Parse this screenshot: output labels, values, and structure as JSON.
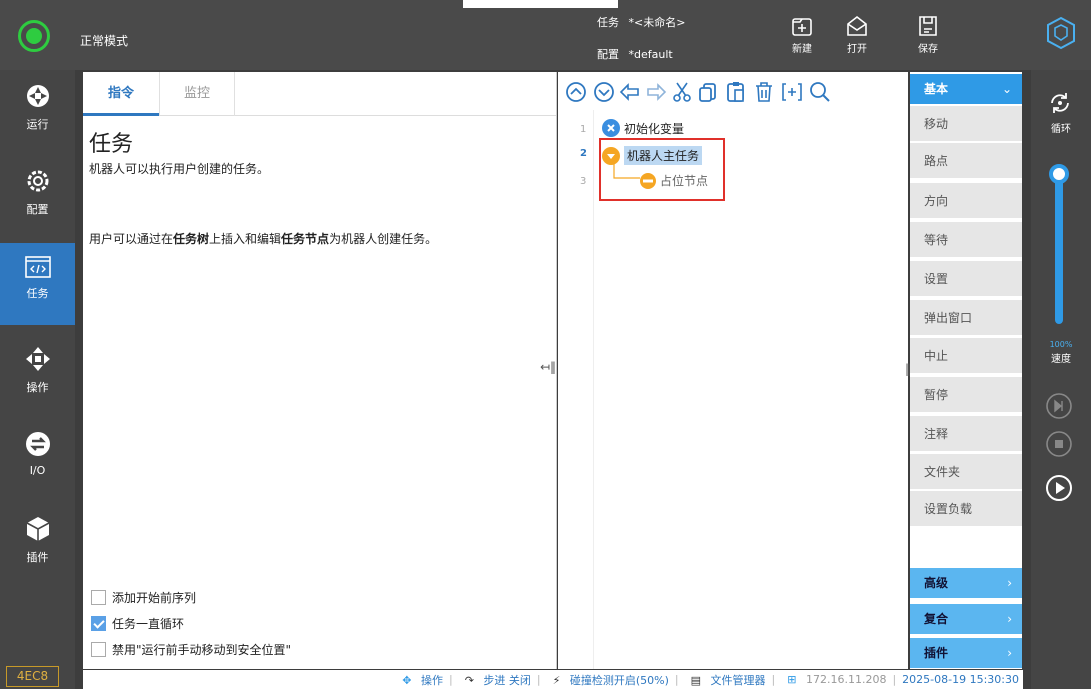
{
  "header": {
    "mode": "正常模式",
    "task_label": "任务",
    "task_value": "*<未命名>",
    "config_label": "配置",
    "config_value": "*default",
    "new_label": "新建",
    "open_label": "打开",
    "save_label": "保存"
  },
  "nav": {
    "run": "运行",
    "config": "配置",
    "task": "任务",
    "operate": "操作",
    "io": "I/O",
    "plugin": "插件",
    "version": "4EC8"
  },
  "panel": {
    "tab_instructions": "指令",
    "tab_monitor": "监控",
    "title": "任务",
    "desc1": "机器人可以执行用户创建的任务。",
    "desc2_a": "用户可以通过在",
    "desc2_b": "任务树",
    "desc2_c": "上插入和编辑",
    "desc2_d": "任务节点",
    "desc2_e": "为机器人创建任务。",
    "cb1": "添加开始前序列",
    "cb2": "任务一直循环",
    "cb3": "禁用\"运行前手动移动到安全位置\"",
    "collapse": "↤‖"
  },
  "tree": {
    "lines": [
      "1",
      "2",
      "3"
    ],
    "node1": "初始化变量",
    "node2": "机器人主任务",
    "node3": "占位节点",
    "collapse": "‖↦"
  },
  "commands": {
    "header": "基本",
    "items": [
      "移动",
      "路点",
      "方向",
      "等待",
      "设置",
      "弹出窗口",
      "中止",
      "暂停",
      "注释",
      "文件夹",
      "设置负载"
    ],
    "advanced": "高级",
    "composite": "复合",
    "plugin": "插件"
  },
  "right": {
    "loop": "循环",
    "speed_pct": "100%",
    "speed": "速度"
  },
  "status": {
    "operate": "操作",
    "step": "步进 关闭",
    "collision": "碰撞检测开启(50%)",
    "files": "文件管理器",
    "ip": "172.16.11.208",
    "datetime": "2025-08-19 15:30:30"
  },
  "colors": {
    "accent": "#2f78c0",
    "highlight_red": "#e0302a",
    "status_green": "#2ecc40",
    "node_orange": "#f5a623"
  }
}
